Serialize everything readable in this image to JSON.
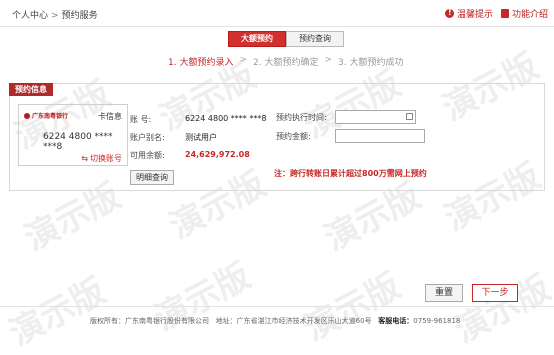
{
  "breadcrumb": {
    "items": [
      "个人中心",
      "预约服务"
    ],
    "sep": ">"
  },
  "top_links": {
    "tips": "温馨提示",
    "intro": "功能介绍"
  },
  "tabs": [
    "大额预约",
    "预约查询"
  ],
  "steps": [
    "1. 大额预约录入",
    "2. 大额预约确定",
    "3. 大额预约成功"
  ],
  "panel": {
    "title": "预约信息"
  },
  "card": {
    "bank_name": "广东南粤银行",
    "info_label": "卡信息",
    "number": "6224 4800 **** ***8",
    "switch_label": "切换账号"
  },
  "fields": {
    "account_label": "账    号:",
    "account_value": "6224 4800 **** ***8",
    "alias_label": "账户别名:",
    "alias_value": "测试用户",
    "balance_label": "可用余额:",
    "balance_value": "24,629,972.08",
    "exec_time_label": "预约执行时间:",
    "amount_label": "预约金额:"
  },
  "detail_button": "明细查询",
  "note": "注：跨行转账日累计超过800万需网上预约",
  "buttons": {
    "reset": "重置",
    "next": "下一步"
  },
  "footer": {
    "copyright": "版权所有：广东南粤银行股份有限公司",
    "address": "地址：广东省湛江市经济技术开发区乐山大道60号",
    "hotline_label": "客服电话：",
    "hotline": "0759-961818"
  },
  "watermark": "演示版"
}
